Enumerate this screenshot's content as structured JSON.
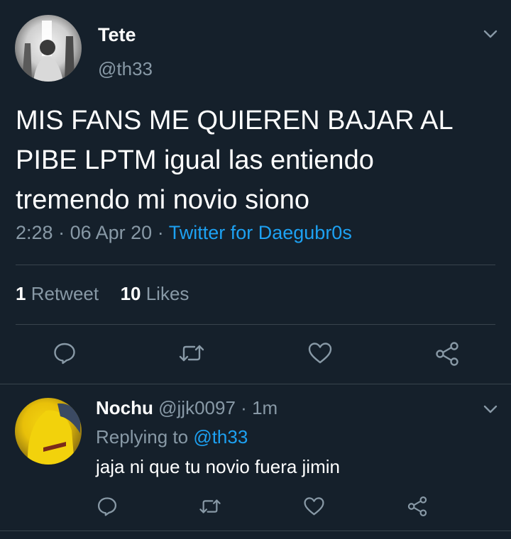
{
  "tweet": {
    "author_name": "Tete",
    "author_handle": "@th33",
    "text": "MIS FANS ME QUIEREN BAJAR AL PIBE LPTM igual las entiendo tremendo mi novio siono",
    "time": "2:28",
    "date": "06 Apr 20",
    "separator": "·",
    "source": "Twitter for Daegubr0s",
    "retweet_count": "1",
    "retweet_label": "Retweet",
    "likes_count": "10",
    "likes_label": "Likes"
  },
  "reply": {
    "author_name": "Nochu",
    "author_handle": "@jjk0097",
    "age": "1m",
    "replying_prefix": "Replying to",
    "replying_to": "@th33",
    "text": "jaja ni que tu novio fuera jimin"
  },
  "icons": {
    "menu": "chevron-down-icon",
    "reply": "comment-icon",
    "retweet": "retweet-icon",
    "like": "heart-icon",
    "share": "share-icon"
  },
  "colors": {
    "background": "#15202b",
    "text_primary": "#ffffff",
    "text_secondary": "#8899a6",
    "accent": "#1da1f2",
    "divider": "#38444d"
  }
}
